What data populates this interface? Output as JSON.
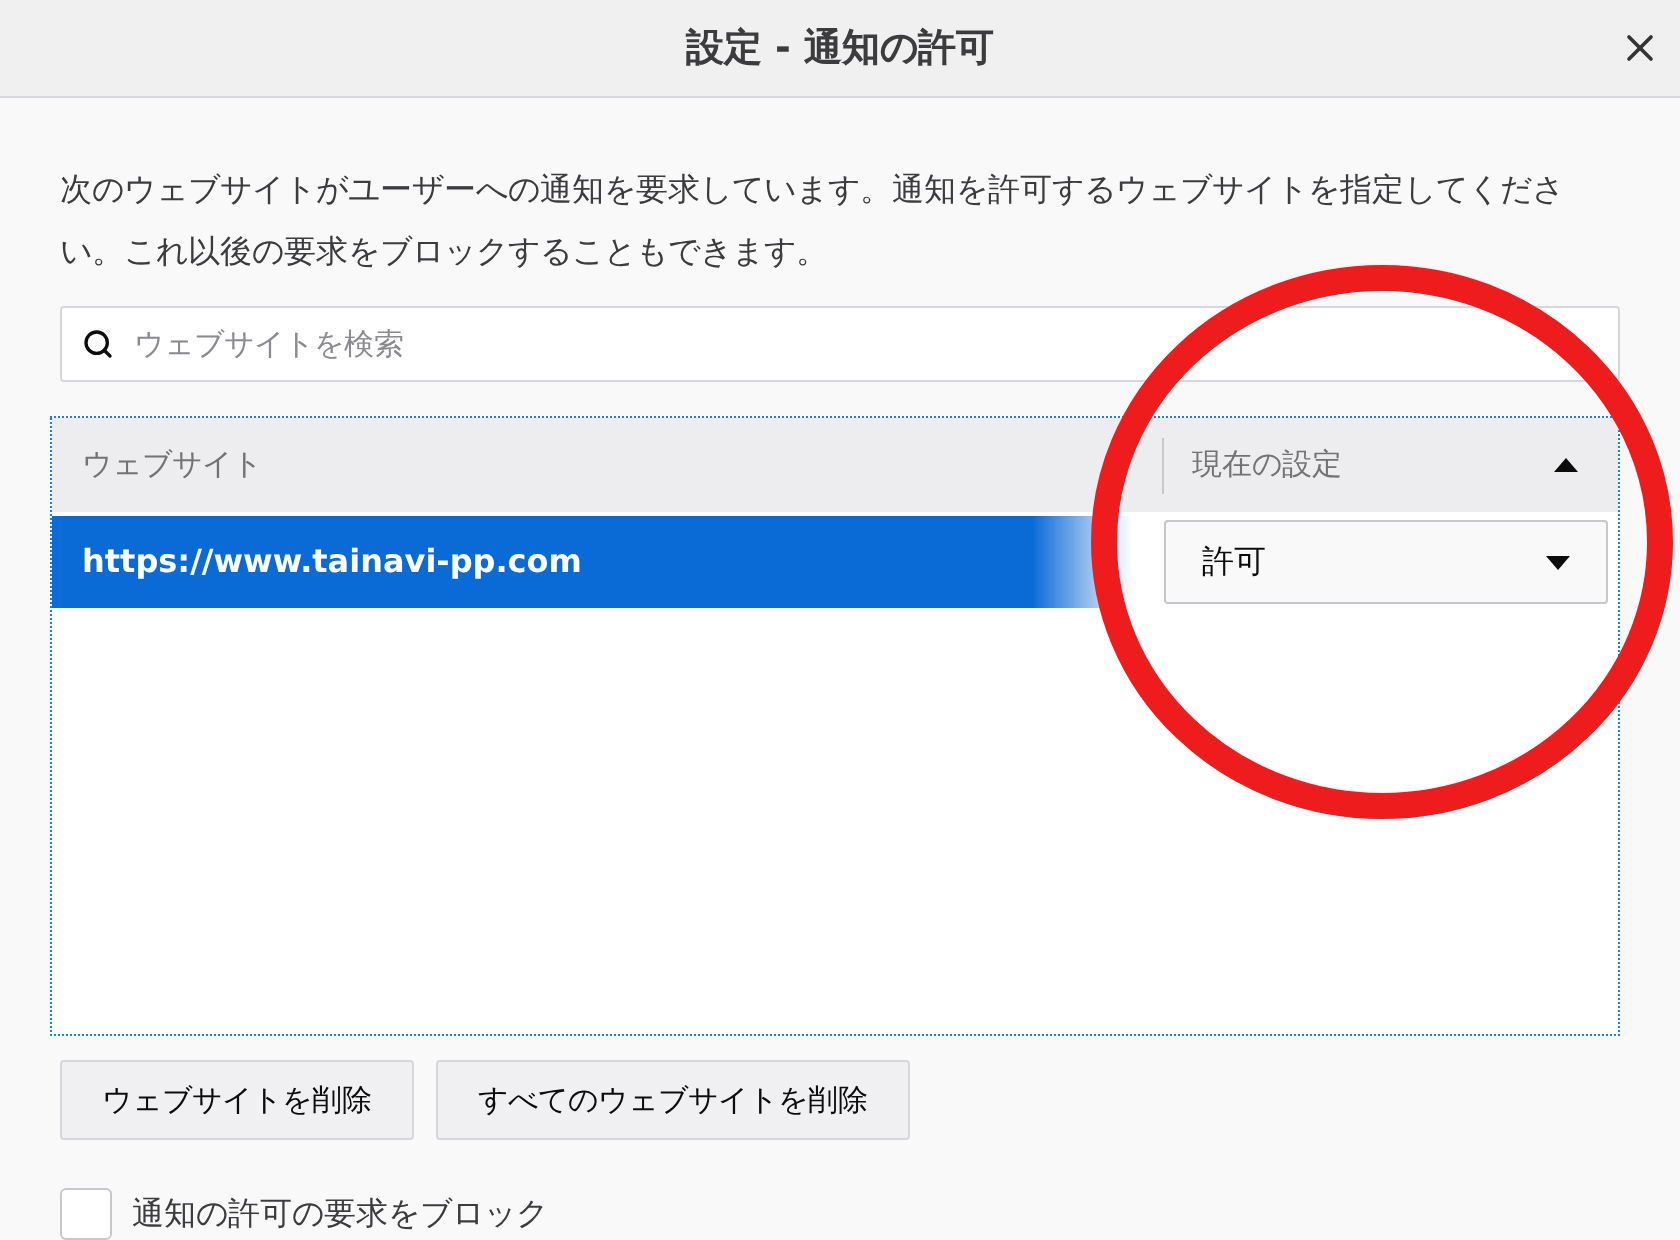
{
  "window": {
    "title": "設定 - 通知の許可"
  },
  "description": "次のウェブサイトがユーザーへの通知を要求しています。通知を許可するウェブサイトを指定してください。これ以後の要求をブロックすることもできます。",
  "search": {
    "placeholder": "ウェブサイトを検索"
  },
  "table": {
    "columns": [
      {
        "label": "ウェブサイト",
        "sorted": false
      },
      {
        "label": "現在の設定",
        "sorted": true
      }
    ],
    "rows": [
      {
        "website": "https://www.tainavi-pp.com",
        "status": "許可",
        "selected": true
      }
    ]
  },
  "buttons": [
    "ウェブサイトを削除",
    "すべてのウェブサイトを削除"
  ],
  "block_checkbox": {
    "label": "通知の許可の要求をブロック",
    "checked": false
  }
}
